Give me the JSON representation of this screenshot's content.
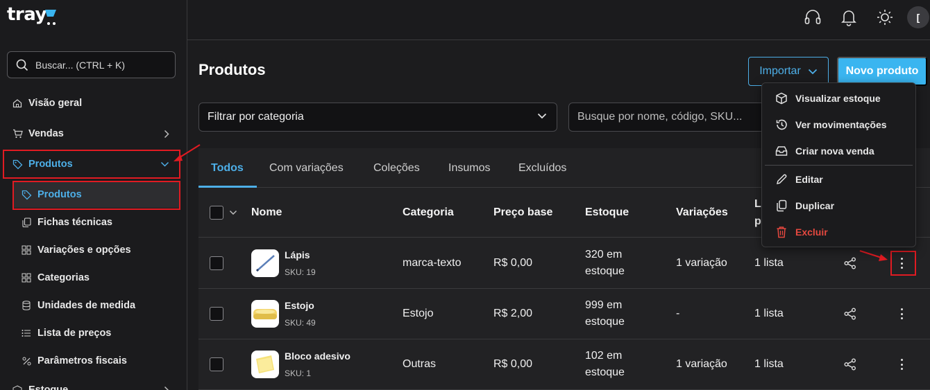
{
  "brand": {
    "logo_text": "tray"
  },
  "sidebar": {
    "search_placeholder": "Buscar... (CTRL + K)",
    "items": [
      {
        "label": "Visão geral",
        "icon": "home-icon"
      },
      {
        "label": "Vendas",
        "icon": "cart-icon"
      },
      {
        "label": "Produtos",
        "icon": "tag-icon",
        "expanded": true
      },
      {
        "label": "Estoque",
        "icon": "box-icon"
      }
    ],
    "sub_items": [
      {
        "label": "Produtos",
        "icon": "tag-icon",
        "selected": true
      },
      {
        "label": "Fichas técnicas",
        "icon": "copy-icon"
      },
      {
        "label": "Variações e opções",
        "icon": "grid-icon"
      },
      {
        "label": "Categorias",
        "icon": "grid-icon"
      },
      {
        "label": "Unidades de medida",
        "icon": "database-icon"
      },
      {
        "label": "Lista de preços",
        "icon": "list-icon"
      },
      {
        "label": "Parâmetros fiscais",
        "icon": "percent-icon"
      }
    ]
  },
  "topbar": {
    "icons": [
      "headset-icon",
      "bell-icon",
      "sun-icon"
    ],
    "avatar_initial": "["
  },
  "page": {
    "title": "Produtos",
    "import_label": "Importar",
    "new_product_label": "Novo produto",
    "filter_label": "Filtrar por categoria",
    "search_placeholder": "Busque por nome, código, SKU..."
  },
  "tabs": [
    {
      "label": "Todos",
      "active": true
    },
    {
      "label": "Com variações"
    },
    {
      "label": "Coleções"
    },
    {
      "label": "Insumos"
    },
    {
      "label": "Excluídos"
    }
  ],
  "table": {
    "headers": {
      "nome": "Nome",
      "categoria": "Categoria",
      "preco": "Preço base",
      "estoque": "Estoque",
      "variacoes": "Variações",
      "listas_1": "L",
      "listas_2": "p"
    },
    "rows": [
      {
        "name": "Lápis",
        "sku": "SKU: 19",
        "category": "marca-texto",
        "price": "R$ 0,00",
        "stock_1": "320 em",
        "stock_2": "estoque",
        "variations": "1 variação",
        "lists": "1 lista"
      },
      {
        "name": "Estojo",
        "sku": "SKU: 49",
        "category": "Estojo",
        "price": "R$ 2,00",
        "stock_1": "999 em",
        "stock_2": "estoque",
        "variations": "-",
        "lists": "1 lista"
      },
      {
        "name": "Bloco adesivo",
        "sku": "SKU: 1",
        "category": "Outras",
        "price": "R$ 0,00",
        "stock_1": "102 em",
        "stock_2": "estoque",
        "variations": "1 variação",
        "lists": "1 lista"
      }
    ]
  },
  "context_menu": {
    "items": [
      {
        "label": "Visualizar estoque",
        "icon": "cube-icon"
      },
      {
        "label": "Ver movimentações",
        "icon": "history-icon"
      },
      {
        "label": "Criar nova venda",
        "icon": "inbox-icon"
      },
      {
        "label": "Editar",
        "icon": "pencil-icon"
      },
      {
        "label": "Duplicar",
        "icon": "duplicate-icon"
      },
      {
        "label": "Excluir",
        "icon": "trash-icon",
        "danger": true
      }
    ]
  },
  "colors": {
    "accent": "#4dafe8",
    "primary_button": "#3ab5f0",
    "danger": "#e5483f",
    "highlight": "#e11b22",
    "background": "#1c1c1e"
  }
}
